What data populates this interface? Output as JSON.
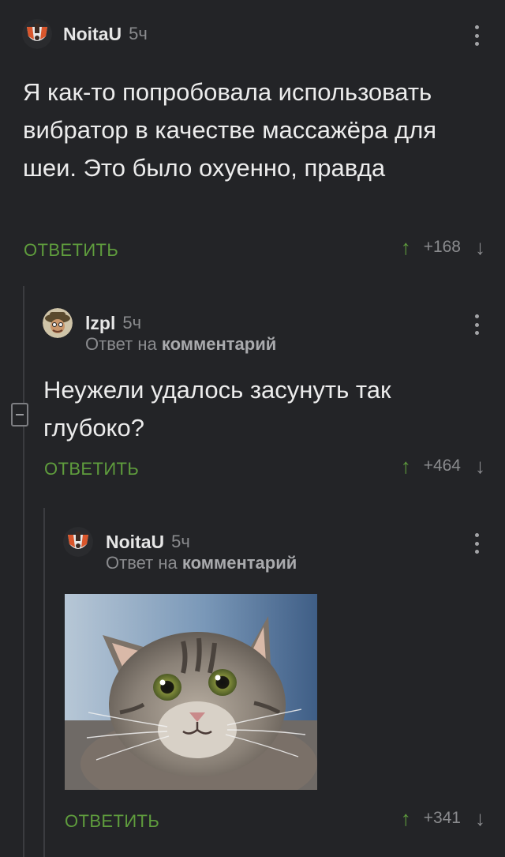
{
  "comments": [
    {
      "user": "NoitaU",
      "time": "5ч",
      "text": "Я как-то попробовала использовать вибратор в качестве массажёра для шеи. Это было охуенно, правда",
      "reply_label": "ОТВЕТИТЬ",
      "score": "+168"
    },
    {
      "user": "lzpl",
      "time": "5ч",
      "reply_to_prefix": "Ответ на",
      "reply_to_target": "комментарий",
      "text": "Неужели удалось засунуть так глубоко?",
      "reply_label": "ОТВЕТИТЬ",
      "score": "+464"
    },
    {
      "user": "NoitaU",
      "time": "5ч",
      "reply_to_prefix": "Ответ на",
      "reply_to_target": "комментарий",
      "image": "surprised-cat-photo",
      "reply_label": "ОТВЕТИТЬ",
      "score": "+341"
    }
  ],
  "icons": {
    "upvote": "↑",
    "downvote": "↓"
  },
  "colors": {
    "background": "#232427",
    "accent": "#5f9d3d",
    "muted": "#8a8b8e"
  }
}
